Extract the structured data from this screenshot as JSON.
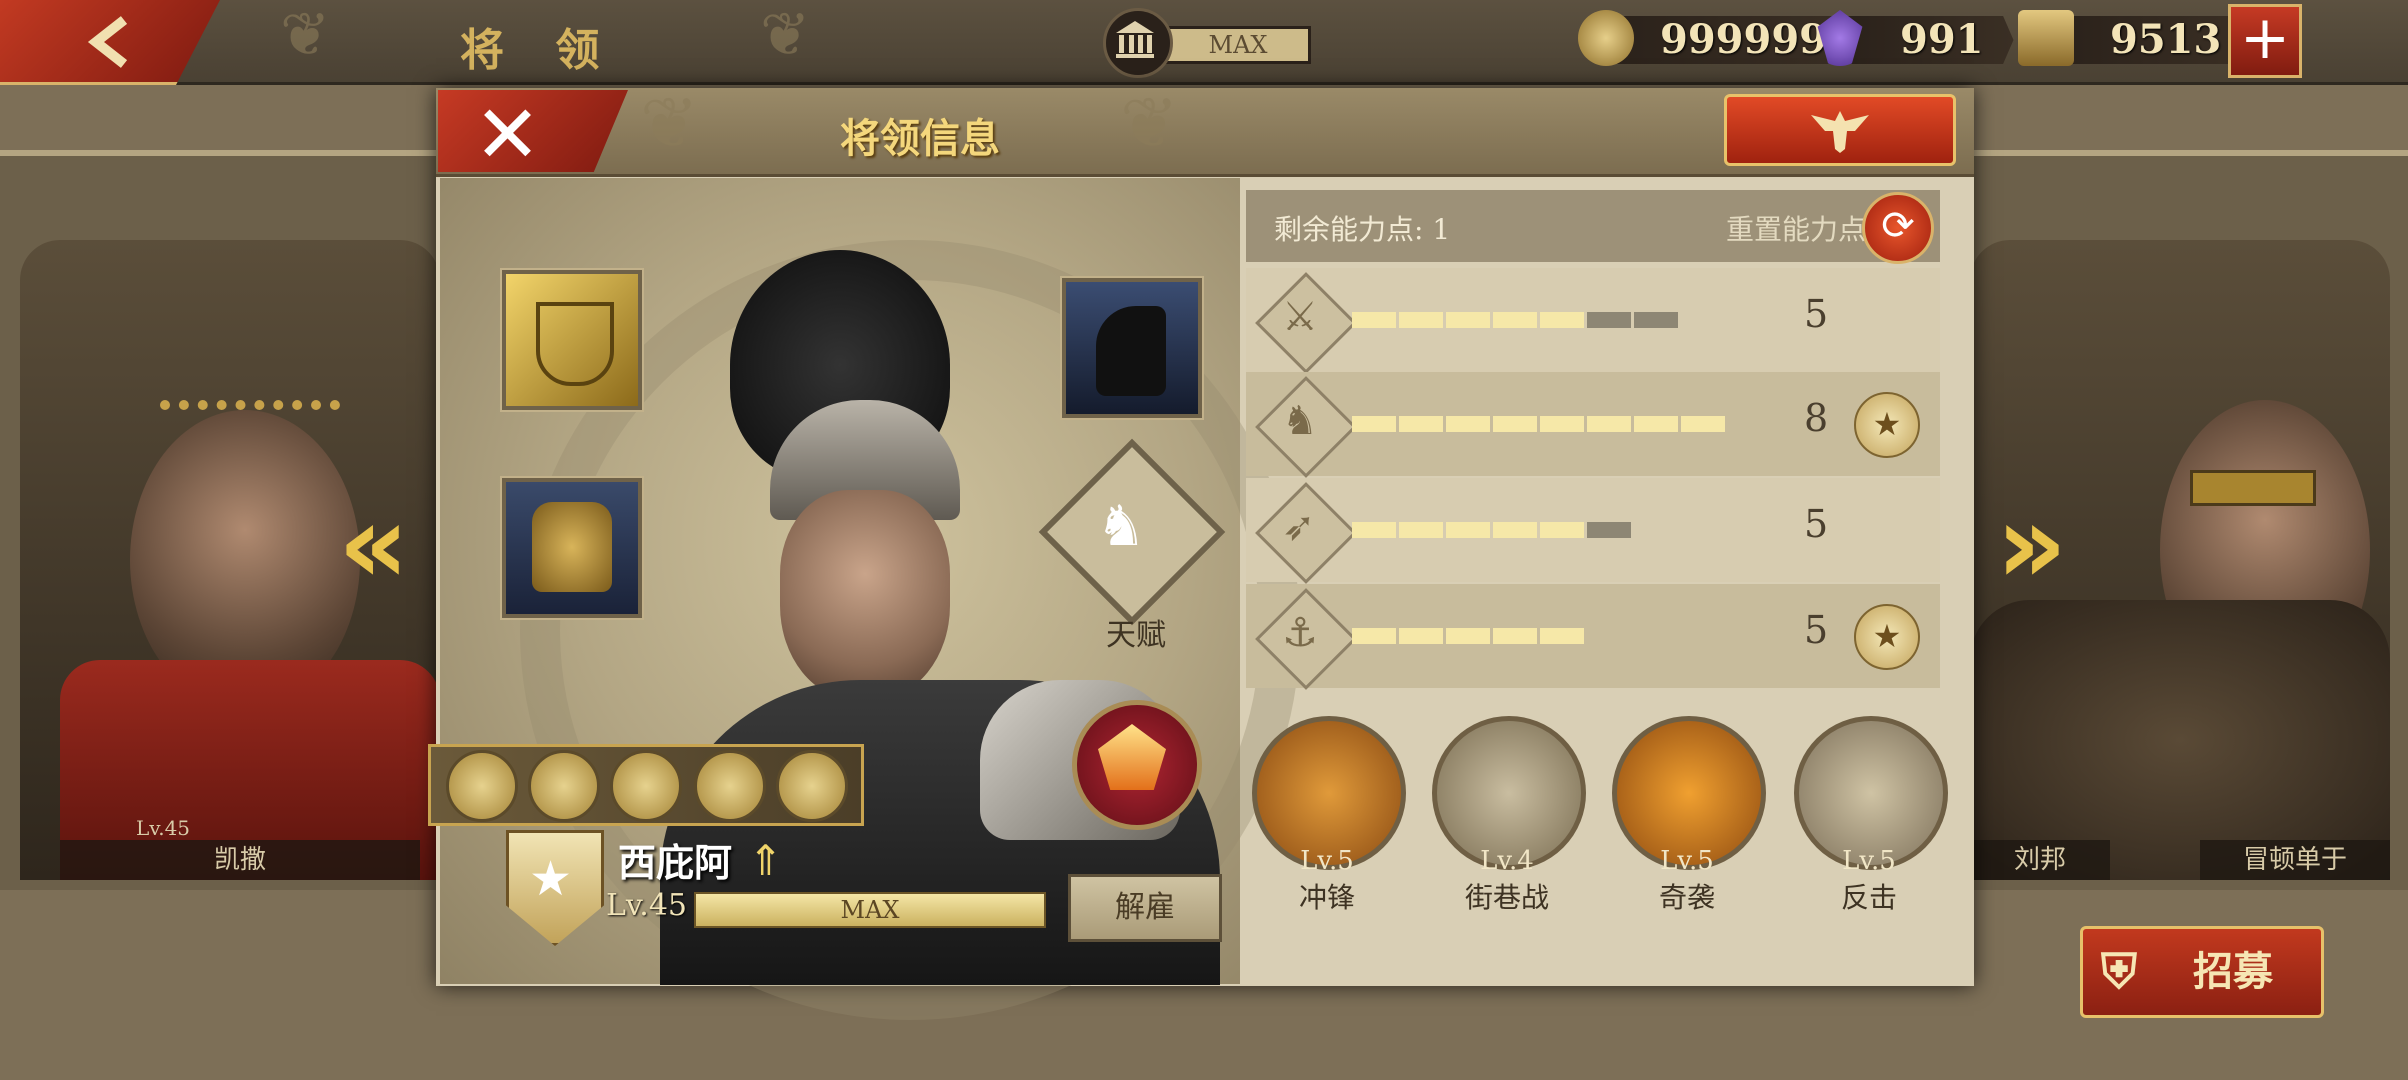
{
  "top": {
    "title": "将 领",
    "capacity": "MAX",
    "coins": "999999",
    "gems": "991",
    "spqr": "9513",
    "plus": "+"
  },
  "heroes_bg": {
    "left_name": "凯撒",
    "left_level": "Lv.45",
    "right_name_1": "刘邦",
    "right_name_2": "冒顿单于"
  },
  "dialog": {
    "title": "将领信息",
    "close": "✕",
    "talent_label": "天赋",
    "hero_name": "西庇阿",
    "level": "Lv.45",
    "exp_text": "MAX",
    "exp_fraction": 1.0,
    "dismiss": "解雇"
  },
  "stats": {
    "remaining_label": "剩余能力点: 1",
    "reset_label": "重置能力点",
    "rows": [
      {
        "icon": "sword-icon",
        "value": "5",
        "filled": 5,
        "total": 7,
        "medal": false
      },
      {
        "icon": "horse-icon",
        "value": "8",
        "filled": 8,
        "total": 8,
        "medal": true
      },
      {
        "icon": "bow-icon",
        "value": "5",
        "filled": 5,
        "total": 6,
        "medal": false
      },
      {
        "icon": "anchor-icon",
        "value": "5",
        "filled": 5,
        "total": 5,
        "medal": true
      }
    ]
  },
  "skills": [
    {
      "level": "Lv.5",
      "name": "冲锋"
    },
    {
      "level": "Lv.4",
      "name": "街巷战"
    },
    {
      "level": "Lv.5",
      "name": "奇袭"
    },
    {
      "level": "Lv.5",
      "name": "反击"
    }
  ],
  "recruit": "招募",
  "colors": {
    "accent_red": "#c23a22",
    "gold": "#d9b36a",
    "panel": "#d9cfb5"
  }
}
